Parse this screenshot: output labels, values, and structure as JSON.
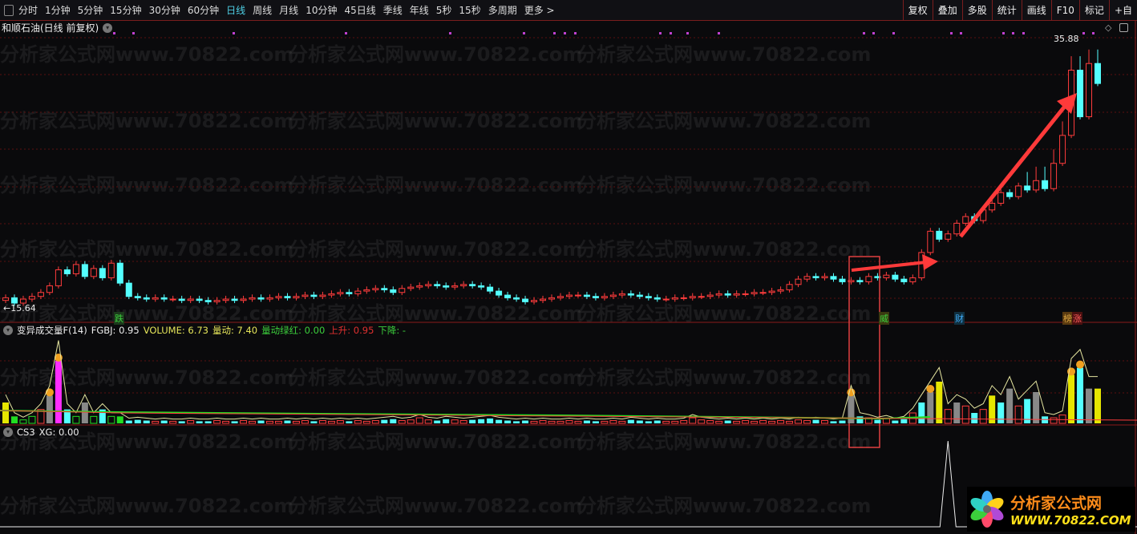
{
  "toolbar": {
    "periods": [
      "分时",
      "1分钟",
      "5分钟",
      "15分钟",
      "30分钟",
      "60分钟",
      "日线",
      "周线",
      "月线",
      "10分钟",
      "45日线",
      "季线",
      "年线",
      "5秒",
      "15秒",
      "多周期",
      "更多 >"
    ],
    "active": "日线",
    "right_buttons": [
      "复权",
      "叠加",
      "多股",
      "统计",
      "画线",
      "F10",
      "标记",
      "+自"
    ]
  },
  "chart_title": "和顺石油(日线 前复权)",
  "price_labels": {
    "high": "35.88",
    "low": "15.64"
  },
  "event_tags": [
    {
      "text": "跌",
      "color": "#3ccf3c"
    },
    {
      "text": "威",
      "color": "#3ccf3c"
    },
    {
      "text": "财",
      "color": "#3fa9f5"
    },
    {
      "text": "榜",
      "color": "#d9a441"
    },
    {
      "text": "涨",
      "color": "#ff5a5a"
    }
  ],
  "indicator1": {
    "name": "变异成交量F(14)",
    "fgbj": "FGBJ: 0.95",
    "volume": "VOLUME: 6.73",
    "liangdong": "量动: 7.40",
    "ldlh": "量动绿红: 0.00",
    "shangsheng": "上升: 0.95",
    "xiajiang": "下降: -"
  },
  "indicator2": {
    "name": "CS3",
    "xg": "XG: 0.00"
  },
  "watermark": "分析家公式网www.70822.com",
  "logo": {
    "title": "分析家公式网",
    "url": "WWW.70822.COM"
  },
  "colors": {
    "up": "#ff3c3c",
    "down": "#54ffff",
    "grid": "#5a1010",
    "arrow": "#ff3a3a"
  },
  "chart_data": {
    "type": "candlestick",
    "price_range": [
      15.64,
      35.88
    ],
    "closes": [
      16.4,
      16.0,
      16.3,
      16.5,
      16.8,
      17.3,
      18.5,
      18.2,
      18.9,
      18.0,
      18.6,
      17.9,
      19.0,
      17.5,
      16.5,
      16.4,
      16.3,
      16.4,
      16.3,
      16.3,
      16.2,
      16.3,
      16.2,
      16.1,
      16.2,
      16.3,
      16.2,
      16.3,
      16.4,
      16.3,
      16.4,
      16.5,
      16.4,
      16.5,
      16.6,
      16.5,
      16.6,
      16.7,
      16.8,
      16.7,
      16.9,
      17.0,
      17.1,
      17.0,
      16.8,
      17.1,
      17.2,
      17.3,
      17.4,
      17.3,
      17.2,
      17.3,
      17.4,
      17.3,
      17.2,
      16.9,
      16.6,
      16.4,
      16.3,
      16.1,
      16.2,
      16.3,
      16.4,
      16.5,
      16.6,
      16.6,
      16.5,
      16.4,
      16.5,
      16.6,
      16.7,
      16.6,
      16.5,
      16.4,
      16.3,
      16.3,
      16.4,
      16.4,
      16.5,
      16.5,
      16.6,
      16.7,
      16.6,
      16.7,
      16.7,
      16.8,
      16.8,
      16.9,
      17.0,
      17.4,
      17.8,
      18.0,
      17.9,
      18.0,
      17.8,
      17.6,
      17.7,
      17.6,
      18.0,
      17.9,
      18.1,
      17.8,
      17.6,
      17.9,
      19.8,
      21.4,
      20.8,
      21.2,
      22.0,
      22.5,
      22.2,
      23.0,
      23.5,
      24.3,
      24.0,
      24.8,
      24.5,
      25.2,
      24.6,
      26.5,
      28.6,
      33.5,
      30.0,
      34.0,
      32.5
    ],
    "volume": [
      3,
      1,
      0.5,
      1,
      2,
      4,
      9,
      2,
      1,
      3,
      1,
      2,
      1,
      1,
      0.4,
      0.5,
      0.4,
      0.3,
      0.4,
      0.3,
      0.3,
      0.4,
      0.3,
      0.3,
      0.4,
      0.3,
      0.3,
      0.4,
      0.3,
      0.4,
      0.3,
      0.3,
      0.4,
      0.3,
      0.4,
      0.3,
      0.4,
      0.3,
      0.4,
      0.3,
      0.4,
      0.3,
      0.4,
      0.5,
      0.6,
      0.4,
      0.5,
      0.8,
      0.5,
      0.4,
      0.6,
      0.5,
      0.4,
      0.5,
      0.6,
      0.7,
      0.5,
      0.4,
      0.3,
      0.4,
      0.3,
      0.4,
      0.3,
      0.3,
      0.4,
      0.3,
      0.4,
      0.3,
      0.3,
      0.4,
      0.3,
      0.5,
      0.4,
      0.3,
      0.4,
      0.3,
      0.3,
      0.4,
      0.8,
      0.5,
      0.4,
      0.3,
      0.4,
      0.3,
      0.4,
      0.3,
      0.4,
      0.3,
      0.4,
      0.3,
      0.5,
      0.4,
      0.5,
      0.4,
      0.3,
      0.4,
      4,
      1,
      0.8,
      0.5,
      0.7,
      0.4,
      0.6,
      1.5,
      3,
      4.5,
      6,
      2,
      3,
      2.5,
      1.5,
      2,
      4,
      3,
      5,
      2.5,
      3.5,
      4.5,
      1,
      0.8,
      1.2,
      7,
      8,
      5,
      5
    ],
    "xg_signal_index": 107
  }
}
